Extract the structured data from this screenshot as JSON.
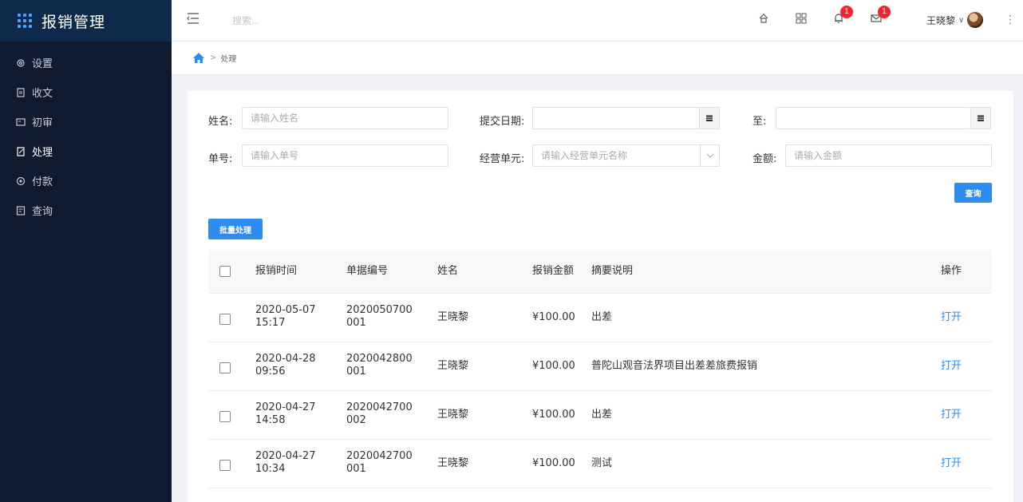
{
  "brand": {
    "title": "报销管理"
  },
  "sidebar": {
    "items": [
      {
        "label": "设置",
        "icon": "gear-icon"
      },
      {
        "label": "收文",
        "icon": "document-icon"
      },
      {
        "label": "初审",
        "icon": "review-icon"
      },
      {
        "label": "处理",
        "icon": "edit-doc-icon",
        "active": true
      },
      {
        "label": "付款",
        "icon": "payment-icon"
      },
      {
        "label": "查询",
        "icon": "query-icon"
      }
    ]
  },
  "header": {
    "search_placeholder": "搜索...",
    "notifications_count": "1",
    "messages_count": "1",
    "user_name": "王晓黎",
    "user_chevron": "∨",
    "more": "⋮"
  },
  "breadcrumb": {
    "separator": ">",
    "current": "处理"
  },
  "filters": {
    "name_label": "姓名:",
    "name_placeholder": "请输入姓名",
    "date_label": "提交日期:",
    "to_label": "至:",
    "no_label": "单号:",
    "no_placeholder": "请输入单号",
    "unit_label": "经营单元:",
    "unit_placeholder": "请输入经营单元名称",
    "amount_label": "金额:",
    "amount_placeholder": "请输入金额",
    "query_button": "查询"
  },
  "batch_button": "批量处理",
  "table": {
    "headers": {
      "time": "报销时间",
      "no": "单据编号",
      "name": "姓名",
      "amount": "报销金额",
      "desc": "摘要说明",
      "op": "操作"
    },
    "rows": [
      {
        "time": "2020-05-07 15:17",
        "no": "2020050700001",
        "name": "王晓黎",
        "amount": "¥100.00",
        "desc": "出差",
        "op": "打开"
      },
      {
        "time": "2020-04-28 09:56",
        "no": "2020042800001",
        "name": "王晓黎",
        "amount": "¥100.00",
        "desc": "普陀山观音法界项目出差差旅费报销",
        "op": "打开"
      },
      {
        "time": "2020-04-27 14:58",
        "no": "2020042700002",
        "name": "王晓黎",
        "amount": "¥100.00",
        "desc": "出差",
        "op": "打开"
      },
      {
        "time": "2020-04-27 10:34",
        "no": "2020042700001",
        "name": "王晓黎",
        "amount": "¥100.00",
        "desc": "测试",
        "op": "打开"
      }
    ]
  },
  "colors": {
    "sidebar_bg": "#0f1a2e",
    "brand_bg": "#0d2a4a",
    "primary": "#2d8cf0",
    "badge": "#f5222d"
  }
}
